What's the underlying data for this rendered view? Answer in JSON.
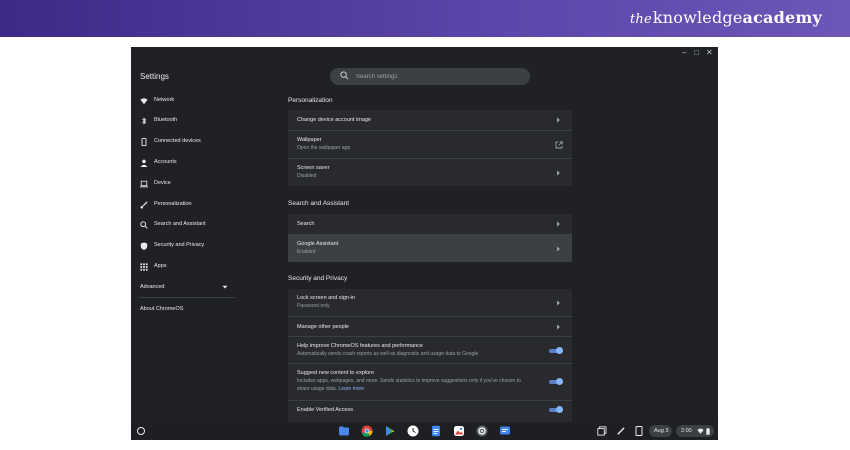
{
  "banner": {
    "brand_the": "the",
    "brand_knowledge": "knowledge",
    "brand_academy": "academy"
  },
  "window": {
    "title": "Settings",
    "search_placeholder": "Search settings"
  },
  "sidebar": {
    "items": [
      {
        "label": "Network",
        "icon": "wifi-icon"
      },
      {
        "label": "Bluetooth",
        "icon": "bluetooth-icon"
      },
      {
        "label": "Connected devices",
        "icon": "phone-icon"
      },
      {
        "label": "Accounts",
        "icon": "person-icon"
      },
      {
        "label": "Device",
        "icon": "laptop-icon"
      },
      {
        "label": "Personalization",
        "icon": "brush-icon"
      },
      {
        "label": "Search and Assistant",
        "icon": "search-icon"
      },
      {
        "label": "Security and Privacy",
        "icon": "shield-icon"
      },
      {
        "label": "Apps",
        "icon": "apps-grid-icon"
      }
    ],
    "advanced_label": "Advanced",
    "about_label": "About ChromeOS"
  },
  "main": {
    "personalization": {
      "title": "Personalization",
      "rows": [
        {
          "label": "Change device account image"
        },
        {
          "label": "Wallpaper",
          "sub": "Open the wallpaper app"
        },
        {
          "label": "Screen saver",
          "sub": "Disabled"
        }
      ]
    },
    "search_assistant": {
      "title": "Search and Assistant",
      "rows": [
        {
          "label": "Search"
        },
        {
          "label": "Google Assistant",
          "sub": "Enabled"
        }
      ]
    },
    "security_privacy": {
      "title": "Security and Privacy",
      "rows": [
        {
          "label": "Lock screen and sign-in",
          "sub": "Password only"
        },
        {
          "label": "Manage other people"
        },
        {
          "label": "Help improve ChromeOS features and performance",
          "sub": "Automatically sends crash reports as well as diagnostic and usage data to Google",
          "toggle": true
        },
        {
          "label": "Suggest new content to explore",
          "sub": "Includes apps, webpages, and more. Sends statistics to improve suggestions only if you've chosen to",
          "sub2": "share usage data.",
          "link": "Learn more",
          "toggle": true
        },
        {
          "label": "Enable Verified Access",
          "toggle": true
        }
      ]
    }
  },
  "shelf": {
    "date": "Aug 3",
    "time": "2:00",
    "apps": [
      "files-app-icon",
      "chrome-icon",
      "play-store-icon",
      "clock-icon",
      "docs-icon",
      "gallery-icon",
      "settings-app-icon",
      "messages-icon"
    ]
  },
  "colors": {
    "background": "#202124",
    "card": "#292a2d",
    "accent": "#8ab4f8",
    "banner": "#4b3797"
  }
}
